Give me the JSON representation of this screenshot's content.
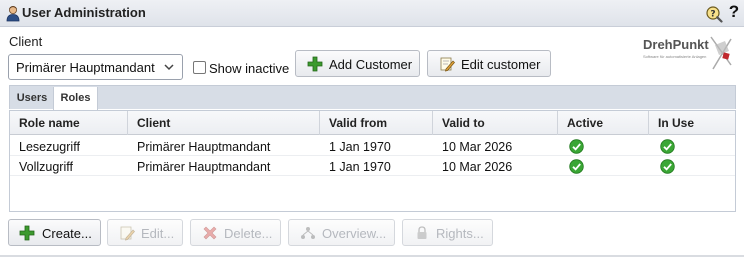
{
  "window": {
    "title": "User Administration",
    "title_icon": "user-icon",
    "help_icon": "help-search-icon",
    "question_mark": "?"
  },
  "client": {
    "label": "Client",
    "selected": "Primärer Hauptmandant",
    "show_inactive_label": "Show inactive",
    "show_inactive_checked": false
  },
  "toolbar": {
    "add_customer": "Add Customer",
    "edit_customer": "Edit customer"
  },
  "logo": {
    "name": "DrehPunkt",
    "tagline": "Software für automatisierte Anlagen"
  },
  "tabs": [
    {
      "label": "Users",
      "active": false
    },
    {
      "label": "Roles",
      "active": true
    }
  ],
  "table": {
    "columns": [
      "Role name",
      "Client",
      "Valid from",
      "Valid to",
      "Active",
      "In Use"
    ],
    "rows": [
      {
        "role": "Lesezugriff",
        "client": "Primärer Hauptmandant",
        "valid_from": "1 Jan 1970",
        "valid_to": "10 Mar 2026",
        "active": true,
        "in_use": true
      },
      {
        "role": "Vollzugriff",
        "client": "Primärer Hauptmandant",
        "valid_from": "1 Jan 1970",
        "valid_to": "10 Mar 2026",
        "active": true,
        "in_use": true
      }
    ]
  },
  "actions": {
    "create": "Create...",
    "edit": "Edit...",
    "delete": "Delete...",
    "overview": "Overview...",
    "rights": "Rights..."
  },
  "colors": {
    "check_green": "#3aa635",
    "add_green": "#3c9a2e",
    "delete_red": "#d9534f",
    "logo_red": "#c0282d"
  }
}
